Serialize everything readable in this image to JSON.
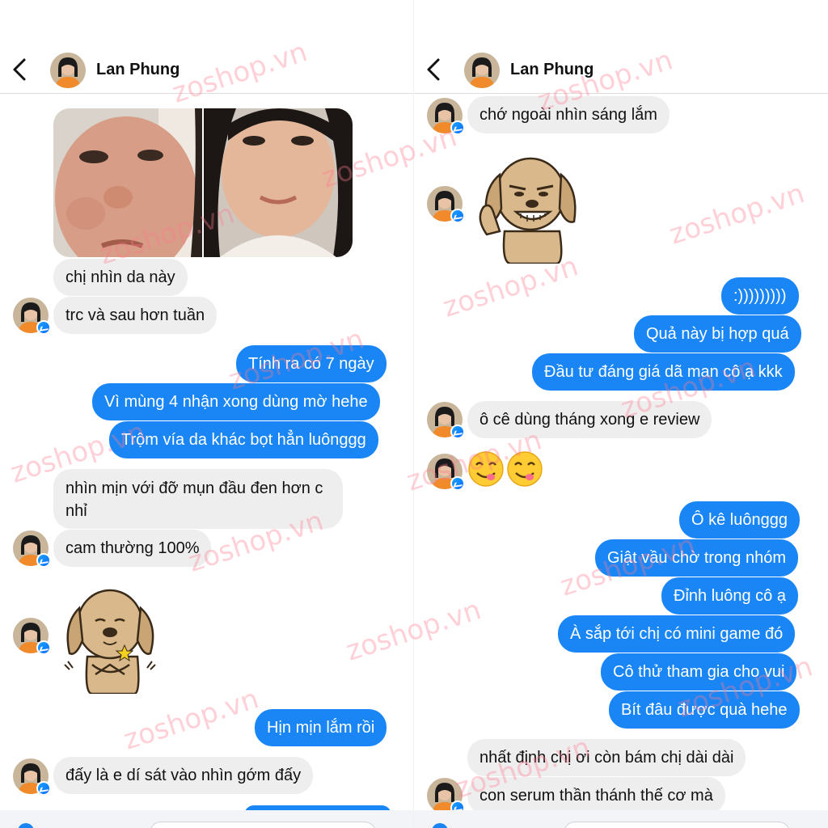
{
  "contact": {
    "name": "Lan Phung"
  },
  "watermark": "zoshop.vn",
  "colors": {
    "outgoing": "#1a86f5",
    "incoming": "#eeeeef",
    "brand_watermark": "#ff788c"
  },
  "left": {
    "messages": {
      "m1": "chị nhìn da này",
      "m2": "trc và sau hơn tuần",
      "m3": "Tính ra có 7 ngày",
      "m4": "Vì mùng 4 nhận xong dùng mờ hehe",
      "m5": "Trộm vía da khác bọt hẳn luônggg",
      "m6": "nhìn mịn với đỡ mụn đầu đen hơn c nhỉ",
      "m7": "cam thường 100%",
      "m8": "Hịn mịn lắm rồi",
      "m9": "đấy là e dí sát vào nhìn gớm đấy"
    }
  },
  "right": {
    "messages": {
      "r1": "chớ ngoài nhìn sáng lắm",
      "r2": ":)))))))))",
      "r3": "Quả này bị hợp quá",
      "r4": "Đầu tư đáng giá dã man cô ạ kkk",
      "r5": "ô cê dùng tháng xong e review",
      "r6": "Ô kê luônggg",
      "r7": "Giật vầu chờ trong nhóm",
      "r8": "Đỉnh luông cô ạ",
      "r9": "À sắp tới chị có mini game đó",
      "r10": "Cô thử tham gia cho vui",
      "r11": "Bít đâu được quà hehe",
      "r12": "nhất định chị ơi còn bám chị dài dài",
      "r13": "con serum thần thánh thế cơ mà"
    }
  }
}
